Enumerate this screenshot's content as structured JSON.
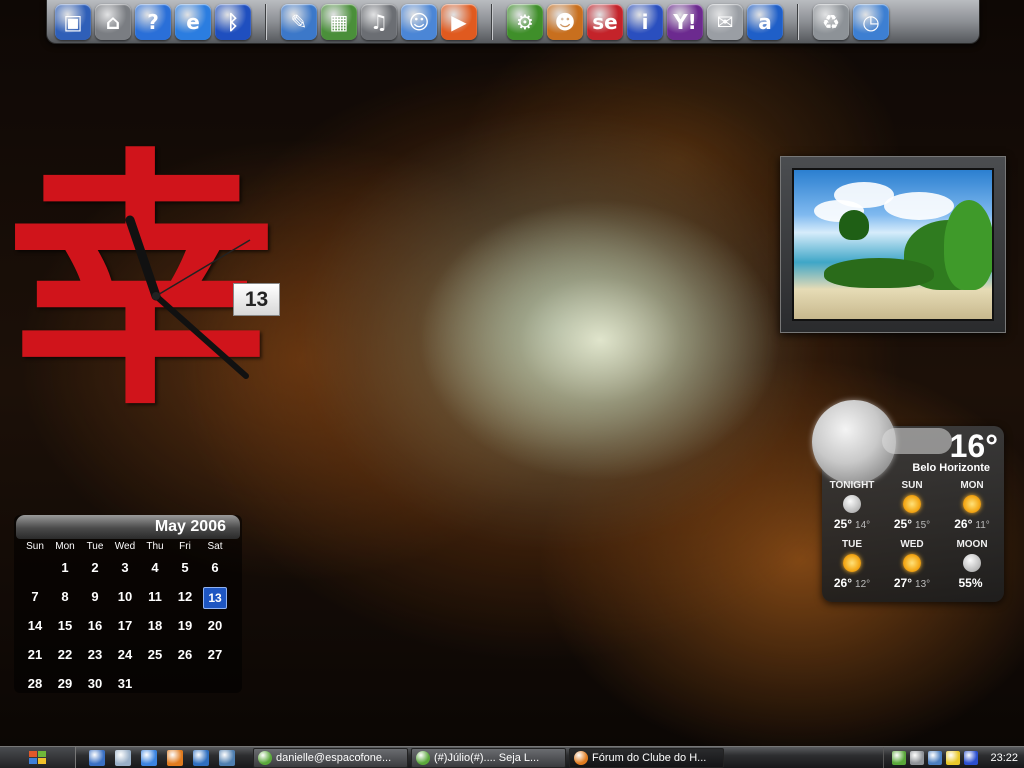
{
  "dock": {
    "icons": [
      {
        "name": "my-computer-icon",
        "glyph": "▣",
        "color": "#2f5fb8"
      },
      {
        "name": "network-icon",
        "glyph": "⌂",
        "color": "#7a7d82"
      },
      {
        "name": "help-icon",
        "glyph": "?",
        "color": "#2a6fd8"
      },
      {
        "name": "internet-explorer-icon",
        "glyph": "e",
        "color": "#2b7de0"
      },
      {
        "name": "bluetooth-icon",
        "glyph": "ᛒ",
        "color": "#1f4fbf"
      },
      {
        "name": "documents-icon",
        "glyph": "✎",
        "color": "#3c78c9"
      },
      {
        "name": "pictures-icon",
        "glyph": "▦",
        "color": "#4a8f3a"
      },
      {
        "name": "music-icon",
        "glyph": "♫",
        "color": "#6b6e73"
      },
      {
        "name": "messenger-icon",
        "glyph": "☺",
        "color": "#4b86d6"
      },
      {
        "name": "media-player-icon",
        "glyph": "▶",
        "color": "#e05a1f"
      },
      {
        "name": "settings-gear-icon",
        "glyph": "⚙",
        "color": "#3f8f2a"
      },
      {
        "name": "users-icon",
        "glyph": "☻",
        "color": "#c86f1e"
      },
      {
        "name": "se-icon",
        "glyph": "se",
        "color": "#c4232a"
      },
      {
        "name": "info-icon",
        "glyph": "i",
        "color": "#2a4fbf"
      },
      {
        "name": "yahoo-widgets-icon",
        "glyph": "Y!",
        "color": "#6c2a8f"
      },
      {
        "name": "mail-icon",
        "glyph": "✉",
        "color": "#9a9ea4"
      },
      {
        "name": "amazon-icon",
        "glyph": "a",
        "color": "#1f5fc8"
      },
      {
        "name": "recycle-bin-icon",
        "glyph": "♻",
        "color": "#8d9297"
      },
      {
        "name": "clock-icon",
        "glyph": "◷",
        "color": "#3d7fd2"
      }
    ]
  },
  "clock": {
    "date": "13"
  },
  "weather": {
    "current_temp": "16°",
    "city": "Belo Horizonte",
    "forecast": [
      {
        "day": "TONIGHT",
        "icon": "moon",
        "hi": "25°",
        "lo": "14°"
      },
      {
        "day": "SUN",
        "icon": "sun",
        "hi": "25°",
        "lo": "15°"
      },
      {
        "day": "MON",
        "icon": "sun",
        "hi": "26°",
        "lo": "11°"
      },
      {
        "day": "TUE",
        "icon": "sun",
        "hi": "26°",
        "lo": "12°"
      },
      {
        "day": "WED",
        "icon": "sun",
        "hi": "27°",
        "lo": "13°"
      },
      {
        "day": "MOON",
        "icon": "moon",
        "hi": "55%",
        "lo": ""
      }
    ]
  },
  "calendar": {
    "title": "May 2006",
    "days_of_week": [
      "Sun",
      "Mon",
      "Tue",
      "Wed",
      "Thu",
      "Fri",
      "Sat"
    ],
    "leading_blanks": 1,
    "days": [
      "1",
      "2",
      "3",
      "4",
      "5",
      "6",
      "7",
      "8",
      "9",
      "10",
      "11",
      "12",
      "13",
      "14",
      "15",
      "16",
      "17",
      "18",
      "19",
      "20",
      "21",
      "22",
      "23",
      "24",
      "25",
      "26",
      "27",
      "28",
      "29",
      "30",
      "31"
    ],
    "today": "13",
    "weekend_color": "#ffffff"
  },
  "taskbar": {
    "quick_launch": [
      {
        "name": "show-desktop-icon",
        "color": "#3a70c4"
      },
      {
        "name": "network-connections-icon",
        "color": "#9ab0c8"
      },
      {
        "name": "ie-quicklaunch-icon",
        "color": "#3b84e0"
      },
      {
        "name": "firefox-quicklaunch-icon",
        "color": "#e07b1f"
      },
      {
        "name": "windows-explorer-icon",
        "color": "#2f6fc0"
      },
      {
        "name": "window-switch-icon",
        "color": "#4f7fb0"
      }
    ],
    "tasks": [
      {
        "label": "danielle@espacofone...",
        "icon_color": "#5aa83a",
        "active": false
      },
      {
        "label": "(#)Júlio(#).... Seja L...",
        "icon_color": "#5aa83a",
        "active": false
      },
      {
        "label": "Fórum do Clube do H...",
        "icon_color": "#e07b1f",
        "active": true
      }
    ],
    "tray_icons": [
      {
        "name": "messenger-tray-icon",
        "color": "#5aa83a"
      },
      {
        "name": "network-tray-icon",
        "color": "#8f9398"
      },
      {
        "name": "display-tray-icon",
        "color": "#4b7fc0"
      },
      {
        "name": "smiley-tray-icon",
        "color": "#e8c82a"
      },
      {
        "name": "bluetooth-tray-icon",
        "color": "#2a4fcf"
      }
    ],
    "time": "23:22"
  }
}
